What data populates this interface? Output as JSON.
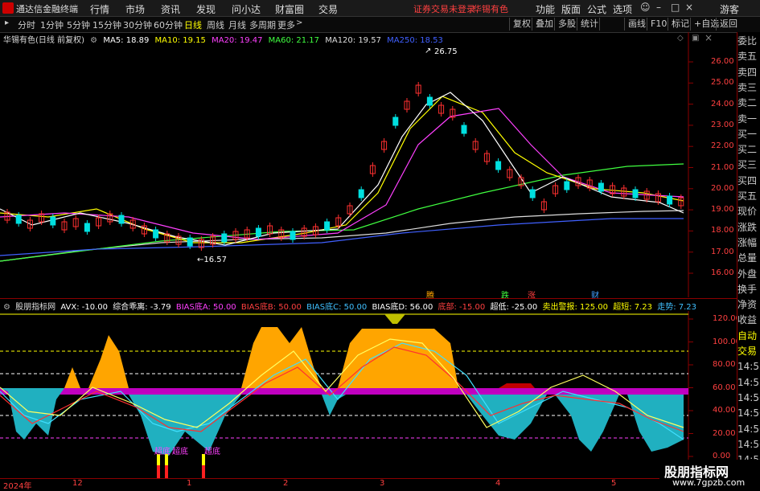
{
  "app": {
    "title": "通达信金融终端"
  },
  "menu": [
    "行情",
    "市场",
    "资讯",
    "发现",
    "问小达",
    "财富圈",
    "交易"
  ],
  "notice": {
    "login": "证券交易未登录",
    "stock": "华锡有色"
  },
  "right_menu": [
    "功能",
    "版面",
    "公式",
    "选项"
  ],
  "guest": "游客",
  "periods": [
    "分时",
    "1分钟",
    "5分钟",
    "15分钟",
    "30分钟",
    "60分钟",
    "日线",
    "周线",
    "月线",
    "多周期",
    "更多"
  ],
  "selected_period": "日线",
  "tools": [
    "复权",
    "叠加",
    "多股",
    "统计",
    "画线",
    "F10",
    "标记",
    "+自选",
    "返回"
  ],
  "chart": {
    "stock_label": "华锡有色(日线 前复权)"
  },
  "ma": [
    {
      "label": "MA5: 18.89",
      "color": "#ffffff"
    },
    {
      "label": "MA10: 19.15",
      "color": "#ffff00"
    },
    {
      "label": "MA20: 19.47",
      "color": "#ff40ff"
    },
    {
      "label": "MA60: 21.17",
      "color": "#40ff40"
    },
    {
      "label": "MA120: 19.57",
      "color": "#dddddd"
    },
    {
      "label": "MA250: 18.53",
      "color": "#4060ff"
    }
  ],
  "price_ticks": [
    "26.00",
    "25.00",
    "24.00",
    "23.00",
    "22.00",
    "21.00",
    "20.00",
    "19.00",
    "18.00",
    "17.00",
    "16.00"
  ],
  "annotations": {
    "high": "26.75",
    "low": "16.57"
  },
  "signals": [
    {
      "text": "腾",
      "color": "#ffa500"
    },
    {
      "text": "跌",
      "color": "#40ff40"
    },
    {
      "text": "涨",
      "color": "#ff4040"
    },
    {
      "text": "财",
      "color": "#40a0ff"
    }
  ],
  "indicator": {
    "name": "股朋指标网",
    "items": [
      {
        "label": "AVX: -10.00",
        "color": "#ffffff"
      },
      {
        "label": "综合乖离: -3.79",
        "color": "#ffffff"
      },
      {
        "label": "BIAS底A: 50.00",
        "color": "#ff40ff"
      },
      {
        "label": "BIAS底B: 50.00",
        "color": "#ff4040"
      },
      {
        "label": "BIAS底C: 50.00",
        "color": "#40c0ff"
      },
      {
        "label": "BIAS底D: 56.00",
        "color": "#ffffff"
      },
      {
        "label": "底部: -15.00",
        "color": "#ff4040"
      },
      {
        "label": "超低: -25.00",
        "color": "#ffffff"
      },
      {
        "label": "卖出警报: 125.00",
        "color": "#ffff00"
      },
      {
        "label": "超短: 7.23",
        "color": "#ffff00"
      },
      {
        "label": "走势: 7.23",
        "color": "#40c0ff"
      }
    ],
    "ticks": [
      "120.00",
      "100.00",
      "80.00",
      "60.00",
      "40.00",
      "20.00",
      "0.00"
    ],
    "tags": [
      "超底",
      "超底",
      "超底"
    ]
  },
  "dates": [
    "2024年",
    "12",
    "1",
    "2",
    "3",
    "4",
    "5"
  ],
  "side_panel": [
    "委比",
    "卖五",
    "卖四",
    "卖三",
    "卖二",
    "卖一",
    "买一",
    "买二",
    "买三",
    "买四",
    "买五",
    "现价",
    "涨跌",
    "涨幅",
    "总量",
    "外盘",
    "换手",
    "净资",
    "收益",
    "自动",
    "交易",
    "14:55",
    "14:55",
    "14:56",
    "14:56",
    "14:56",
    "14:56",
    "14:56",
    "14:56"
  ],
  "watermark": {
    "name": "股朋指标网",
    "url": "www.7gpzb.com"
  }
}
